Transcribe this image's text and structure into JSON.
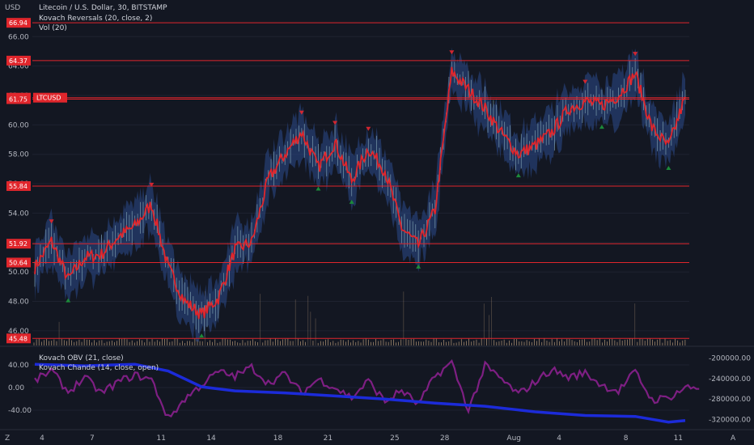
{
  "chart_data": [
    {
      "type": "line",
      "title": "Litecoin / U.S. Dollar, 30, BITSTAMP",
      "ylabel": "USD",
      "ylim": [
        45.0,
        67.5
      ],
      "y_ticks": [
        46.0,
        48.0,
        50.0,
        52.0,
        54.0,
        56.0,
        58.0,
        60.0,
        62.0,
        64.0,
        66.0
      ],
      "x_tick_labels": [
        "4",
        "7",
        "11",
        "14",
        "18",
        "21",
        "25",
        "28",
        "Aug",
        "4",
        "8",
        "11"
      ],
      "symbol_badge": "LTCUSD",
      "legend": [
        "Kovach Reversals (20, close, 2)",
        "Vol (20)"
      ],
      "level_lines": [
        66.94,
        64.37,
        61.85,
        61.75,
        55.84,
        51.92,
        50.64,
        45.48
      ],
      "current_price": 61.85,
      "series": [
        {
          "name": "Litecoin / U.S. Dollar",
          "x": [
            "Jul 3",
            "Jul 4",
            "Jul 5",
            "Jul 6",
            "Jul 7",
            "Jul 8",
            "Jul 9",
            "Jul 10",
            "Jul 11",
            "Jul 12",
            "Jul 13",
            "Jul 14",
            "Jul 15",
            "Jul 16",
            "Jul 17",
            "Jul 18",
            "Jul 19",
            "Jul 20",
            "Jul 21",
            "Jul 22",
            "Jul 23",
            "Jul 24",
            "Jul 25",
            "Jul 26",
            "Jul 27",
            "Jul 28",
            "Jul 29",
            "Jul 30",
            "Jul 31",
            "Aug 1",
            "Aug 2",
            "Aug 3",
            "Aug 4",
            "Aug 5",
            "Aug 6",
            "Aug 7",
            "Aug 8",
            "Aug 9",
            "Aug 10",
            "Aug 11"
          ],
          "values": [
            50.3,
            52.1,
            49.5,
            51.0,
            51.2,
            52.4,
            53.1,
            54.6,
            50.3,
            48.0,
            47.1,
            48.2,
            51.5,
            52.0,
            56.3,
            58.0,
            59.5,
            57.1,
            58.8,
            56.2,
            58.4,
            56.9,
            53.0,
            51.8,
            54.2,
            63.6,
            62.4,
            61.1,
            59.4,
            58.0,
            58.6,
            59.5,
            61.1,
            61.6,
            61.3,
            62.0,
            63.5,
            59.8,
            58.5,
            61.9
          ]
        }
      ]
    },
    {
      "type": "line",
      "legend": [
        "Kovach OBV (21, close)",
        "Kovach Chande (14, close, open)"
      ],
      "ylim_left": [
        -70,
        70
      ],
      "y_ticks_left": [
        40.0,
        0.0,
        -40.0
      ],
      "ylim_right": [
        -335000,
        -180000
      ],
      "y_ticks_right": [
        -200000.0,
        -240000.0,
        -280000.0,
        -320000.0
      ],
      "series": [
        {
          "name": "Kovach OBV (21, close)",
          "axis": "right",
          "x": [
            "Jul 3",
            "Jul 6",
            "Jul 9",
            "Jul 11",
            "Jul 13",
            "Jul 15",
            "Jul 18",
            "Jul 21",
            "Jul 24",
            "Jul 27",
            "Jul 30",
            "Aug 2",
            "Aug 5",
            "Aug 8",
            "Aug 10",
            "Aug 11"
          ],
          "values": [
            -212000,
            -215000,
            -212000,
            -225000,
            -256000,
            -264000,
            -268000,
            -274000,
            -280000,
            -288000,
            -294000,
            -305000,
            -312000,
            -314000,
            -325000,
            -322000
          ]
        },
        {
          "name": "Kovach Chande (14, close, open)",
          "axis": "left",
          "x": [
            "Jul 3",
            "Jul 4",
            "Jul 5",
            "Jul 6",
            "Jul 7",
            "Jul 8",
            "Jul 9",
            "Jul 10",
            "Jul 11",
            "Jul 12",
            "Jul 13",
            "Jul 14",
            "Jul 15",
            "Jul 16",
            "Jul 17",
            "Jul 18",
            "Jul 19",
            "Jul 20",
            "Jul 21",
            "Jul 22",
            "Jul 23",
            "Jul 24",
            "Jul 25",
            "Jul 26",
            "Jul 27",
            "Jul 28",
            "Jul 29",
            "Jul 30",
            "Jul 31",
            "Aug 1",
            "Aug 2",
            "Aug 3",
            "Aug 4",
            "Aug 5",
            "Aug 6",
            "Aug 7",
            "Aug 8",
            "Aug 9",
            "Aug 10",
            "Aug 11"
          ],
          "values": [
            12,
            30,
            -8,
            18,
            -10,
            10,
            22,
            14,
            -55,
            -20,
            5,
            28,
            20,
            36,
            8,
            24,
            -10,
            15,
            0,
            -18,
            12,
            -25,
            -5,
            -30,
            20,
            44,
            -40,
            38,
            14,
            -12,
            10,
            32,
            18,
            26,
            4,
            -6,
            28,
            -22,
            -18,
            0
          ]
        }
      ]
    }
  ],
  "ui": {
    "usd_label": "USD",
    "series_badge": "LTCUSD",
    "corner_left": "Z",
    "corner_right": "A",
    "colors": {
      "background": "#131722",
      "grid": "#1e2230",
      "level_line": "#e0262c",
      "price_line": "#e0262c",
      "band": "#2c4b8c",
      "price_wick": "#8fb4c0",
      "volume": "#d9b58a",
      "obv": "#1c2bd9",
      "chande": "#7e1f83",
      "down_marker": "#d22630",
      "up_marker": "#1c8a3a"
    }
  }
}
